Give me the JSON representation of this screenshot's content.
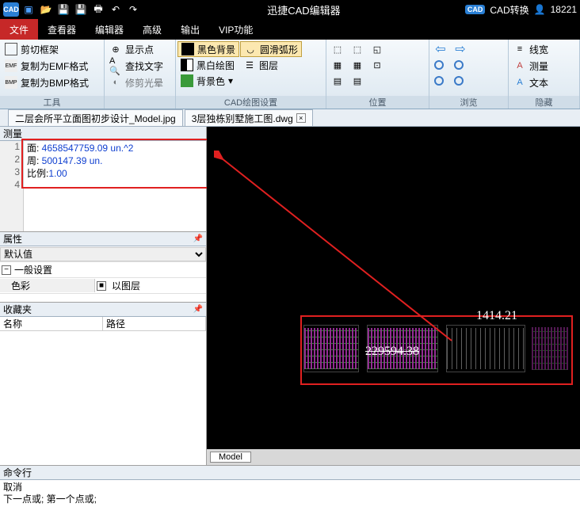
{
  "titlebar": {
    "app_badge": "CAD",
    "title": "迅捷CAD编辑器",
    "convert": "CAD转换",
    "user": "18221"
  },
  "menu": {
    "file": "文件",
    "viewer": "查看器",
    "editor": "编辑器",
    "advanced": "高级",
    "output": "输出",
    "vip": "VIP功能"
  },
  "ribbon": {
    "tools": {
      "crop": "剪切框架",
      "copy_emf": "复制为EMF格式",
      "copy_bmp": "复制为BMP格式",
      "label": "工具"
    },
    "find": {
      "show_pt": "显示点",
      "find_text": "查找文字",
      "trim_halo": "修剪光晕",
      "black_bg": "黑色背景",
      "bw_draw": "黑白绘图",
      "bg_color": "背景色",
      "smooth_arc": "圆滑弧形",
      "layers": "图层",
      "label": "CAD绘图设置"
    },
    "pos": {
      "label": "位置"
    },
    "browse": {
      "label": "浏览"
    },
    "hidden": {
      "linewidth": "线宽",
      "measure": "测量",
      "text": "文本",
      "label": "隐藏"
    }
  },
  "doctabs": {
    "tab1": "二层会所平立面图初步设计_Model.jpg",
    "tab2": "3层独栋别墅施工图.dwg"
  },
  "measure": {
    "title": "测量",
    "line1_label": "面: ",
    "line1_value": "4658547759.09 un.^2",
    "line2_label": "周: ",
    "line2_value": "500147.39 un.",
    "line3_label": "比例:",
    "line3_value": "1.00",
    "ln1": "1",
    "ln2": "2",
    "ln3": "3",
    "ln4": "4"
  },
  "props": {
    "title": "属性",
    "default": "默认值",
    "general": "一般设置",
    "color": "色彩",
    "by_layer": "以图层"
  },
  "fav": {
    "title": "收藏夹",
    "name": "名称",
    "path": "路径"
  },
  "canvas": {
    "model_tab": "Model",
    "dim1": "1414.21",
    "dim2": "229594.38"
  },
  "cmd": {
    "title": "命令行",
    "line1": "取消",
    "line2": "下一点或; 第一个点或;"
  }
}
